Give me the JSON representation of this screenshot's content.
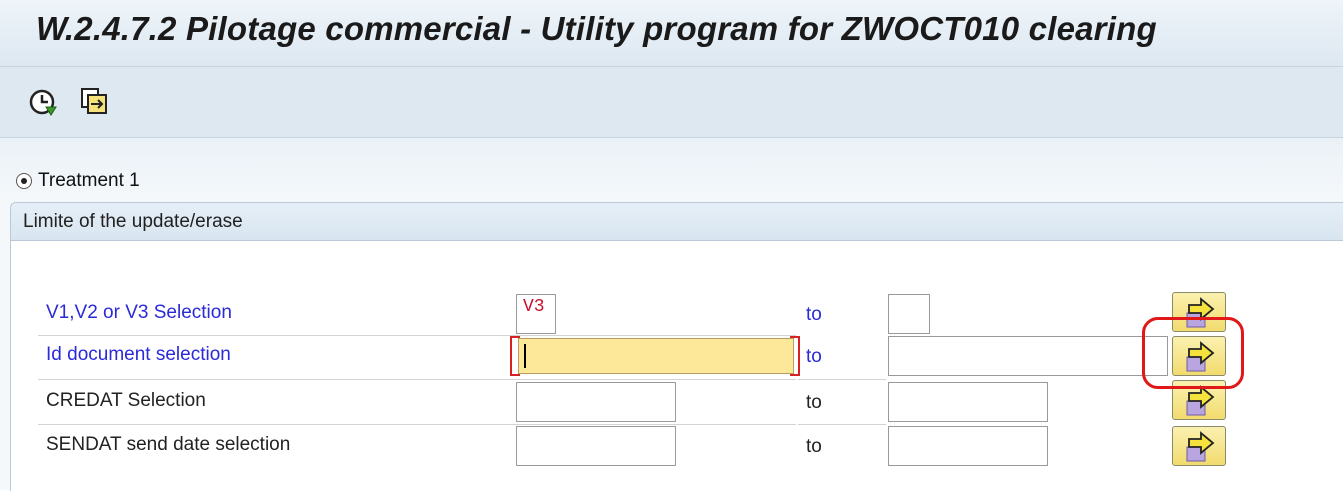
{
  "window": {
    "title": "W.2.4.7.2 Pilotage commercial - Utility program for ZWOCT010 clearing"
  },
  "toolbar": {
    "execute_icon": "execute-clock-icon",
    "variant_icon": "get-variant-icon"
  },
  "radio": {
    "label": "Treatment 1",
    "selected": true
  },
  "group": {
    "header": "Limite of the update/erase"
  },
  "selection_rows": [
    {
      "label": "V1,V2 or V3 Selection",
      "required": true,
      "low": "V3",
      "to_label": "to",
      "high": ""
    },
    {
      "label": "Id document selection",
      "required": true,
      "low": "",
      "to_label": "to",
      "high": "",
      "focused": true
    },
    {
      "label": "CREDAT Selection",
      "required": false,
      "low": "",
      "to_label": "to",
      "high": ""
    },
    {
      "label": "SENDAT send date selection",
      "required": false,
      "low": "",
      "to_label": "to",
      "high": ""
    }
  ],
  "multiple_selection_icon": "multiple-selection-arrow-icon",
  "colors": {
    "required_label": "#2a2ad8",
    "focused_input": "#fde89a",
    "annotation": "#e01818",
    "button_yellow": "#f2db6e"
  }
}
